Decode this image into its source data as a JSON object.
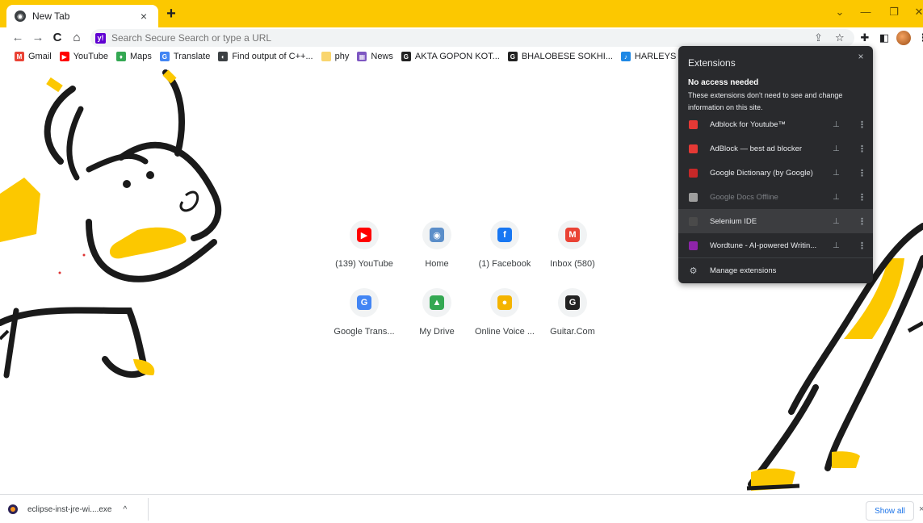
{
  "colors": {
    "accent": "#fcc800",
    "popup_bg": "#292a2d",
    "link_blue": "#1a73e8"
  },
  "tab": {
    "title": "New Tab",
    "favicon": "chrome-icon",
    "close_label": "×",
    "new_tab_label": "+"
  },
  "window_controls": {
    "dropdown": "⌄",
    "minimize": "—",
    "restore": "❐",
    "close": "✕"
  },
  "toolbar": {
    "back": "←",
    "forward": "→",
    "reload": "C",
    "home": "⌂",
    "omnibox_placeholder": "Search Secure Search or type a URL",
    "share": "⇪",
    "star": "☆",
    "extensions": "✚",
    "sidepanel": "◧",
    "menu": "⋮"
  },
  "bookmarks": [
    {
      "label": "Gmail",
      "icon": "gmail-icon",
      "color": "#ea4335",
      "glyph": "M"
    },
    {
      "label": "YouTube",
      "icon": "youtube-icon",
      "color": "#ff0000",
      "glyph": "▶"
    },
    {
      "label": "Maps",
      "icon": "maps-icon",
      "color": "#34a853",
      "glyph": "♦"
    },
    {
      "label": "Translate",
      "icon": "translate-icon",
      "color": "#4285f4",
      "glyph": "G"
    },
    {
      "label": "Find output of C++...",
      "icon": "site-icon",
      "color": "#3c4043",
      "glyph": "◐"
    },
    {
      "label": "phy",
      "icon": "folder-icon",
      "color": "#f9d56e",
      "glyph": ""
    },
    {
      "label": "News",
      "icon": "news-icon",
      "color": "#7e57c2",
      "glyph": "▦"
    },
    {
      "label": "AKTA GOPON KOT...",
      "icon": "chords-icon",
      "color": "#222222",
      "glyph": "G"
    },
    {
      "label": "BHALOBESE SOKHI...",
      "icon": "chords-icon",
      "color": "#222222",
      "glyph": "G"
    },
    {
      "label": "HARLEYS IN HAWAI...",
      "icon": "music-icon",
      "color": "#1e88e5",
      "glyph": "♪"
    }
  ],
  "shortcuts": [
    {
      "label": "(139) YouTube",
      "icon": "youtube-icon",
      "color": "#ff0000",
      "glyph": "▶"
    },
    {
      "label": "Home",
      "icon": "home-site-icon",
      "color": "#5b8ec9",
      "glyph": "◉"
    },
    {
      "label": "(1) Facebook",
      "icon": "facebook-icon",
      "color": "#1877f2",
      "glyph": "f"
    },
    {
      "label": "Inbox (580)",
      "icon": "gmail-icon",
      "color": "#ea4335",
      "glyph": "M"
    },
    {
      "label": "Google Trans...",
      "icon": "translate-icon",
      "color": "#4285f4",
      "glyph": "G"
    },
    {
      "label": "My Drive",
      "icon": "drive-icon",
      "color": "#34a853",
      "glyph": "▲"
    },
    {
      "label": "Online Voice ...",
      "icon": "voice-icon",
      "color": "#f4b400",
      "glyph": "●"
    },
    {
      "label": "Guitar.Com",
      "icon": "chords-icon",
      "color": "#222222",
      "glyph": "G"
    }
  ],
  "extensions_popup": {
    "title": "Extensions",
    "close": "×",
    "section_title": "No access needed",
    "section_desc": "These extensions don't need to see and change information on this site.",
    "items": [
      {
        "name": "Adblock for Youtube™",
        "icon": "adblock-youtube-icon",
        "color": "#e53935",
        "dim": false
      },
      {
        "name": "AdBlock — best ad blocker",
        "icon": "adblock-hand-icon",
        "color": "#e53935",
        "dim": false
      },
      {
        "name": "Google Dictionary (by Google)",
        "icon": "dictionary-icon",
        "color": "#c62828",
        "dim": false
      },
      {
        "name": "Google Docs Offline",
        "icon": "docs-offline-icon",
        "color": "#9e9e9e",
        "dim": true
      },
      {
        "name": "Selenium IDE",
        "icon": "selenium-icon",
        "color": "#4a4a4a",
        "dim": false
      },
      {
        "name": "Wordtune - AI-powered Writin...",
        "icon": "wordtune-icon",
        "color": "#8e24aa",
        "dim": false
      }
    ],
    "pin_glyph": "⊥",
    "more_glyph": "⋮",
    "manage_label": "Manage extensions",
    "manage_glyph": "⚙"
  },
  "download_bar": {
    "file_name": "eclipse-inst-jre-wi....exe",
    "caret": "^",
    "show_all_label": "Show all",
    "close": "×"
  }
}
